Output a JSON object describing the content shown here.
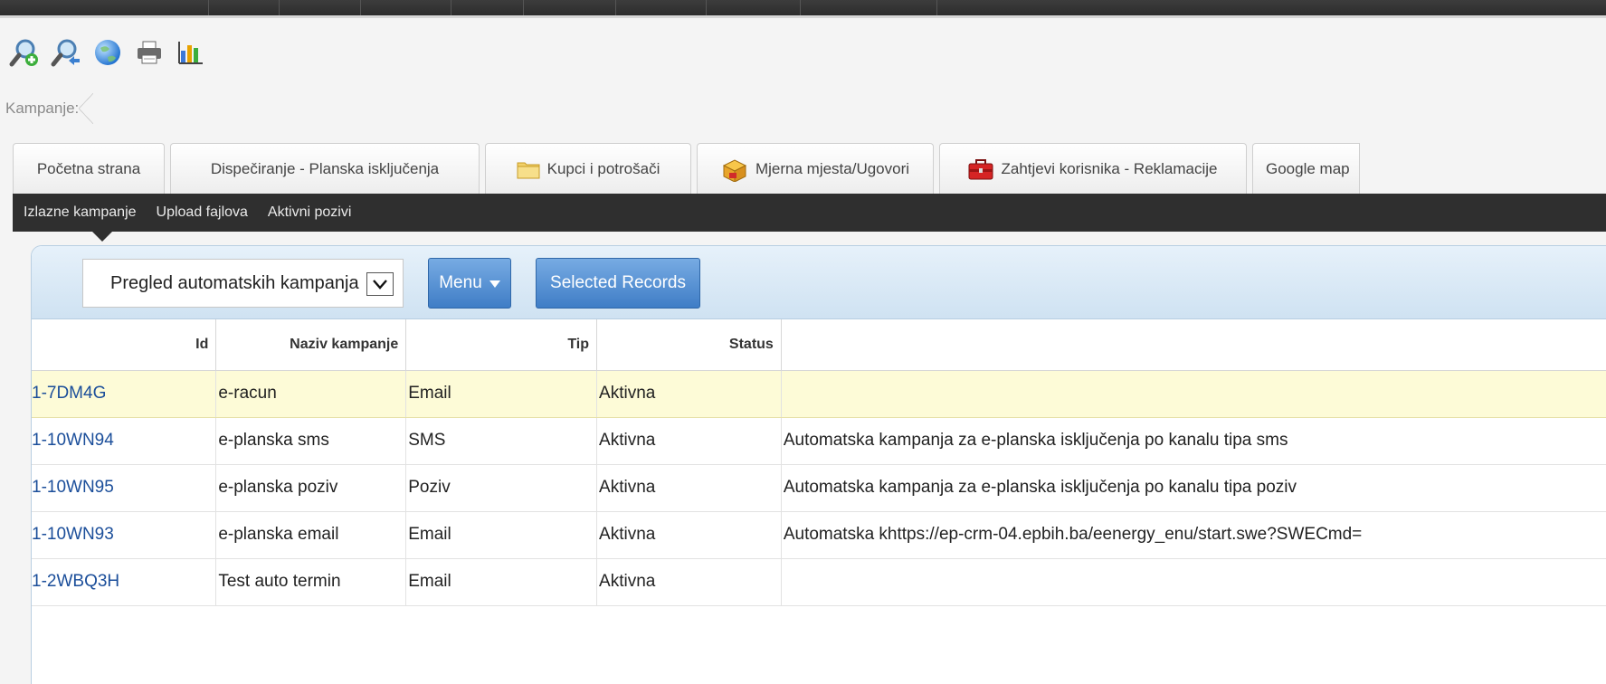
{
  "toolbar": {
    "buttons": [
      {
        "name": "zoom-in-search-icon",
        "label": ""
      },
      {
        "name": "zoom-search-icon",
        "label": ""
      },
      {
        "name": "globe-icon",
        "label": ""
      },
      {
        "name": "printer-icon",
        "label": ""
      },
      {
        "name": "bar-chart-icon",
        "label": ""
      }
    ]
  },
  "breadcrumb": {
    "label": "Kampanje:"
  },
  "tabs": [
    {
      "label": "Početna strana",
      "icon": ""
    },
    {
      "label": "Dispečiranje - Planska isključenja",
      "icon": ""
    },
    {
      "label": "Kupci i potrošači",
      "icon": "folder-icon"
    },
    {
      "label": "Mjerna mjesta/Ugovori",
      "icon": "box-icon"
    },
    {
      "label": "Zahtjevi korisnika - Reklamacije",
      "icon": "toolbox-icon"
    },
    {
      "label": "Google map",
      "icon": ""
    }
  ],
  "subnav": {
    "items": [
      "Izlazne kampanje",
      "Upload fajlova",
      "Aktivni pozivi"
    ],
    "active_index": 0
  },
  "panel": {
    "view_select": {
      "value": "Pregled automatskih kampanja"
    },
    "menu_button": {
      "label": "Menu"
    },
    "selected_records_button": {
      "label": "Selected Records"
    }
  },
  "grid": {
    "columns": [
      "Id",
      "Naziv kampanje",
      "Tip",
      "Status",
      ""
    ],
    "rows": [
      {
        "id": "1-7DM4G",
        "naziv": "e-racun",
        "tip": "Email",
        "status": "Aktivna",
        "opis": ""
      },
      {
        "id": "1-10WN94",
        "naziv": "e-planska sms",
        "tip": "SMS",
        "status": "Aktivna",
        "opis": "Automatska kampanja za e-planska isključenja po kanalu tipa sms"
      },
      {
        "id": "1-10WN95",
        "naziv": "e-planska poziv",
        "tip": "Poziv",
        "status": "Aktivna",
        "opis": "Automatska kampanja za e-planska isključenja po kanalu tipa poziv"
      },
      {
        "id": "1-10WN93",
        "naziv": "e-planska email",
        "tip": "Email",
        "status": "Aktivna",
        "opis": "Automatska khttps://ep-crm-04.epbih.ba/eenergy_enu/start.swe?SWECmd="
      },
      {
        "id": "1-2WBQ3H",
        "naziv": "Test auto termin",
        "tip": "Email",
        "status": "Aktivna",
        "opis": ""
      }
    ],
    "selected_row_index": 0
  },
  "colors": {
    "link": "#1b4e9a",
    "selected_row": "#fdfbd7",
    "button": "#4a86cc",
    "subnav": "#2f2f2f"
  }
}
